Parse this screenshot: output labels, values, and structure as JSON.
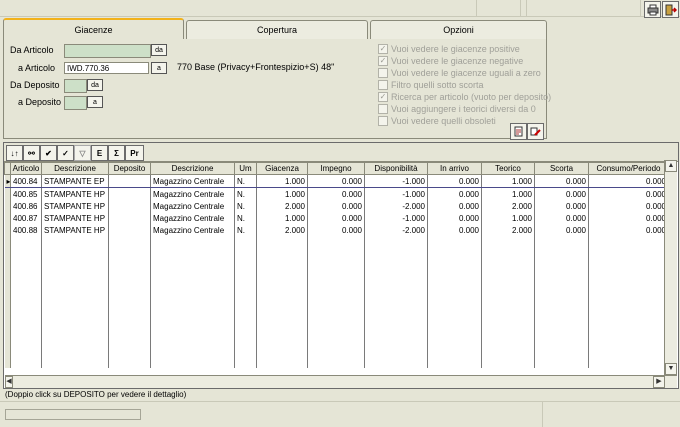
{
  "tabs": [
    {
      "label": "Giacenze"
    },
    {
      "label": "Copertura"
    },
    {
      "label": "Opzioni"
    }
  ],
  "filters": {
    "da_articolo": {
      "label": "Da Articolo",
      "value": "",
      "btn": "da"
    },
    "a_articolo": {
      "label": "a Articolo",
      "value": "IWD.770.36",
      "btn": "a",
      "desc": "770 Base (Privacy+Frontespizio+S) 48\""
    },
    "da_deposito": {
      "label": "Da Deposito",
      "value": "",
      "btn": "da"
    },
    "a_deposito": {
      "label": "a Deposito",
      "value": "",
      "btn": "a"
    }
  },
  "options": [
    {
      "label": "Vuoi vedere le giacenze positive",
      "checked": true
    },
    {
      "label": "Vuoi vedere le giacenze negative",
      "checked": true
    },
    {
      "label": "Vuoi vedere le giacenze uguali a zero",
      "checked": false
    },
    {
      "label": "Filtro quelli sotto scorta",
      "checked": false
    },
    {
      "label": "Ricerca per articolo (vuoto per deposito)",
      "checked": true
    },
    {
      "label": "Vuoi aggiungere i teorici diversi da 0",
      "checked": false
    },
    {
      "label": "Vuoi vedere quelli obsoleti",
      "checked": false
    }
  ],
  "toolbar": {
    "sigma": "Σ",
    "pr": "Pr"
  },
  "grid": {
    "columns": [
      "Articolo",
      "Descrizione",
      "Deposito",
      "Descrizione",
      "Um",
      "Giacenza",
      "Impegno",
      "Disponibilità",
      "In arrivo",
      "Teorico",
      "Scorta",
      "Consumo/Periodo"
    ],
    "rows": [
      [
        "400.84",
        "STAMPANTE EP",
        "",
        "Magazzino Centrale",
        "N.",
        "1.000",
        "0.000",
        "-1.000",
        "0.000",
        "1.000",
        "0.000",
        "0.000"
      ],
      [
        "400.85",
        "STAMPANTE HP",
        "",
        "Magazzino Centrale",
        "N.",
        "1.000",
        "0.000",
        "-1.000",
        "0.000",
        "1.000",
        "0.000",
        "0.000"
      ],
      [
        "400.86",
        "STAMPANTE HP",
        "",
        "Magazzino Centrale",
        "N.",
        "2.000",
        "0.000",
        "-2.000",
        "0.000",
        "2.000",
        "0.000",
        "0.000"
      ],
      [
        "400.87",
        "STAMPANTE HP",
        "",
        "Magazzino Centrale",
        "N.",
        "1.000",
        "0.000",
        "-1.000",
        "0.000",
        "1.000",
        "0.000",
        "0.000"
      ],
      [
        "400.88",
        "STAMPANTE HP",
        "",
        "Magazzino Centrale",
        "N.",
        "2.000",
        "0.000",
        "-2.000",
        "0.000",
        "2.000",
        "0.000",
        "0.000"
      ]
    ]
  },
  "status": {
    "hint": "(Doppio click su DEPOSITO per vedere il dettaglio)"
  }
}
